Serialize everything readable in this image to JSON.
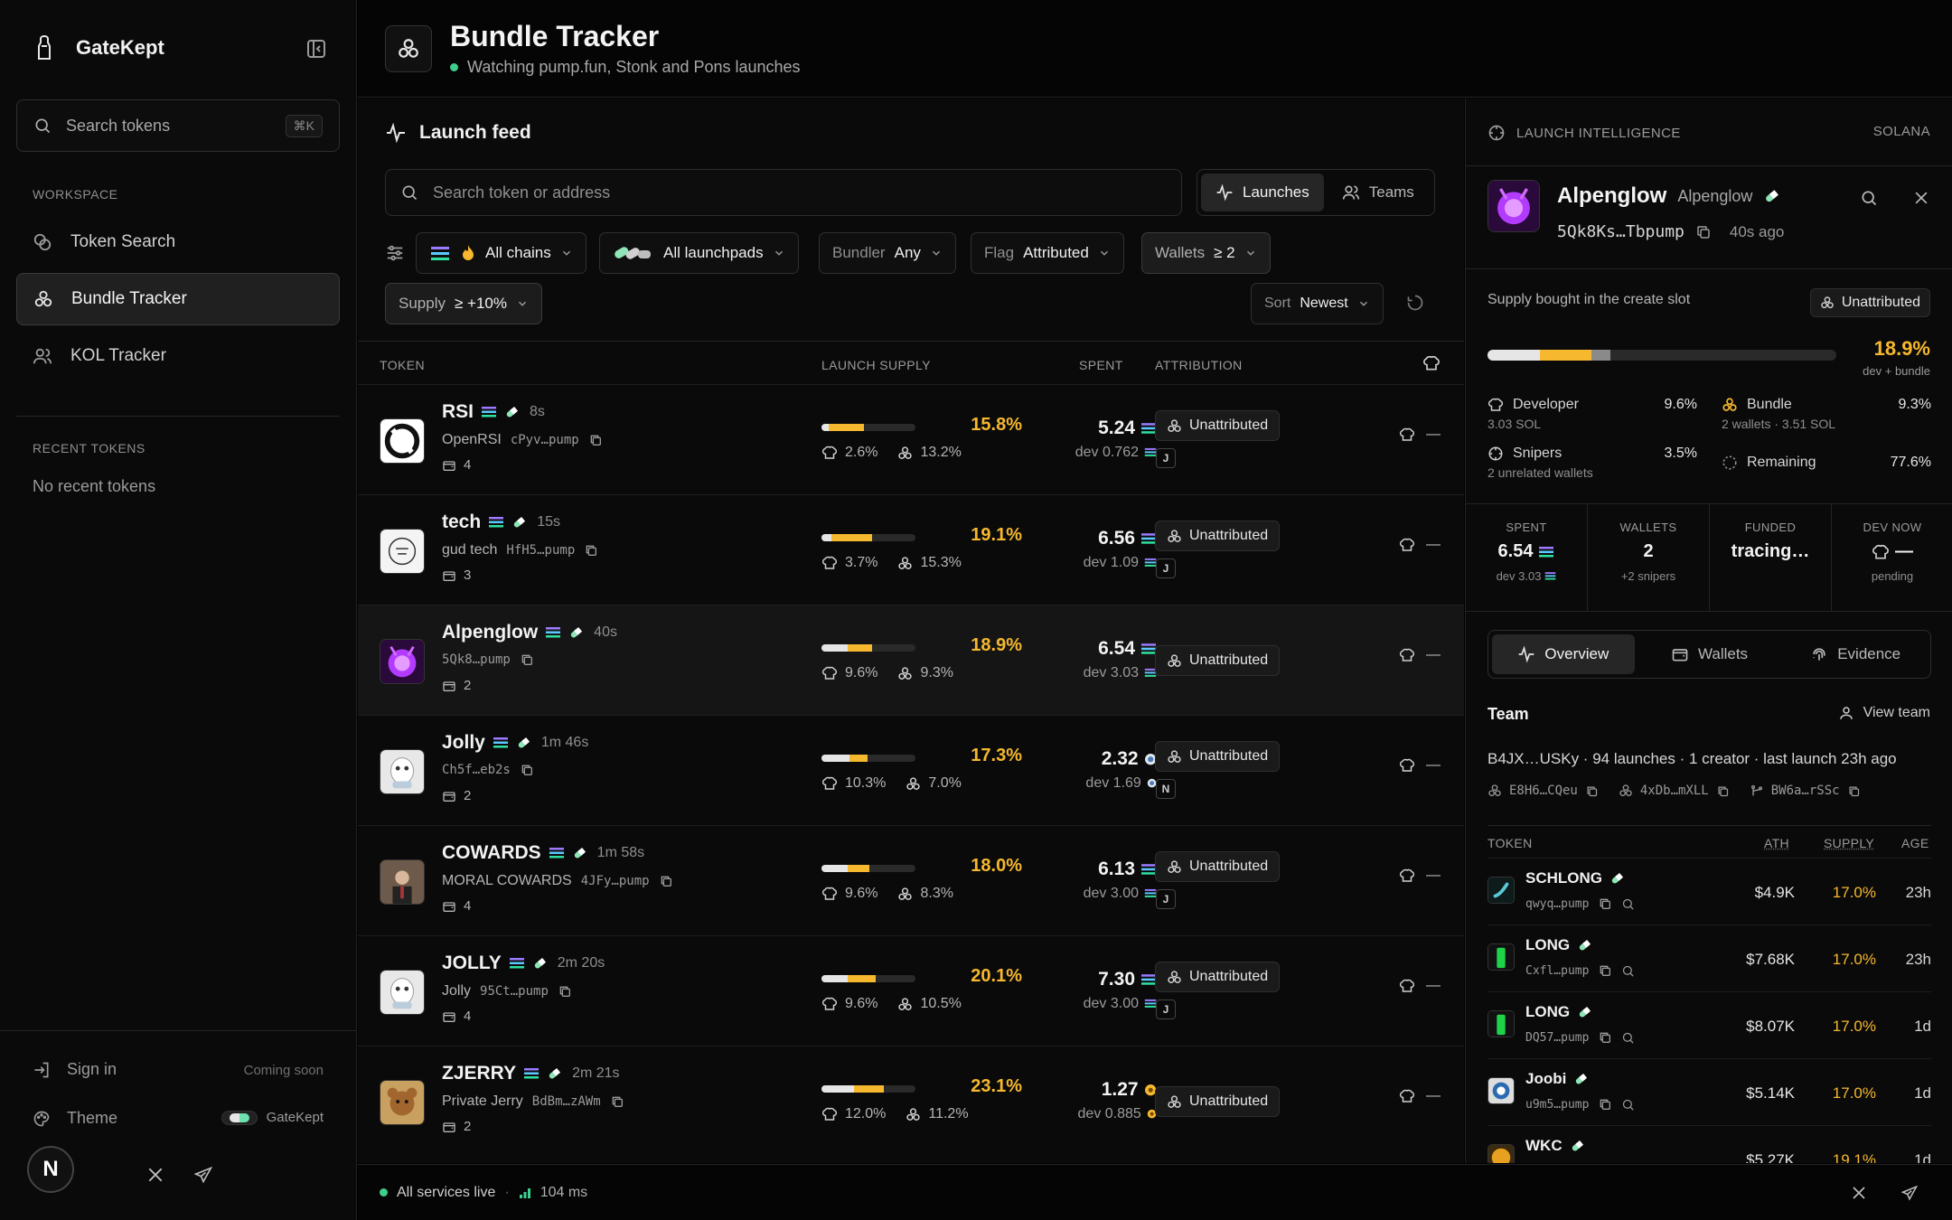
{
  "sidebar": {
    "brand": "GateKept",
    "search_placeholder": "Search tokens",
    "search_shortcut": "⌘K",
    "workspace_label": "WORKSPACE",
    "nav": [
      "Token Search",
      "Bundle Tracker",
      "KOL Tracker"
    ],
    "recent_label": "RECENT TOKENS",
    "recent_empty": "No recent tokens",
    "sign_in": "Sign in",
    "coming_soon": "Coming soon",
    "theme": "Theme",
    "theme_value": "GateKept",
    "avatar": "N"
  },
  "header": {
    "title": "Bundle Tracker",
    "subtitle": "Watching pump.fun, Stonk and Pons launches"
  },
  "feed": {
    "title": "Launch feed",
    "search_placeholder": "Search token or address",
    "modes": [
      "Launches",
      "Teams"
    ],
    "filters": {
      "chains": "All chains",
      "launchpads": "All launchpads",
      "bundler_k": "Bundler",
      "bundler_v": "Any",
      "flag_k": "Flag",
      "flag_v": "Attributed",
      "wallets_k": "Wallets",
      "wallets_v": "≥ 2",
      "supply_k": "Supply",
      "supply_v": "≥ +10%",
      "sort_k": "Sort",
      "sort_v": "Newest"
    },
    "columns": [
      "TOKEN",
      "LAUNCH SUPPLY",
      "SPENT",
      "ATTRIBUTION"
    ],
    "rows": [
      {
        "name": "RSI",
        "age": "8s",
        "desc": "OpenRSI",
        "addr": "cPyv…pump",
        "wallets": "4",
        "supply": "15.8%",
        "dev_pct": "2.6%",
        "bundle_pct": "13.2%",
        "dev_frac": 2.6,
        "bundle_frac": 13.2,
        "spent": "5.24",
        "dev_spent": "dev 0.762",
        "attribution": "Unattributed",
        "tag": "J",
        "coin": "sol",
        "img": "rsi"
      },
      {
        "name": "tech",
        "age": "15s",
        "desc": "gud tech",
        "addr": "HfH5…pump",
        "wallets": "3",
        "supply": "19.1%",
        "dev_pct": "3.7%",
        "bundle_pct": "15.3%",
        "dev_frac": 3.7,
        "bundle_frac": 15.3,
        "spent": "6.56",
        "dev_spent": "dev 1.09",
        "attribution": "Unattributed",
        "tag": "J",
        "coin": "sol",
        "img": "tech"
      },
      {
        "name": "Alpenglow",
        "age": "40s",
        "desc": "",
        "addr": "5Qk8…pump",
        "wallets": "2",
        "supply": "18.9%",
        "dev_pct": "9.6%",
        "bundle_pct": "9.3%",
        "dev_frac": 9.6,
        "bundle_frac": 9.3,
        "spent": "6.54",
        "dev_spent": "dev 3.03",
        "attribution": "Unattributed",
        "tag": "",
        "coin": "sol",
        "img": "alpen"
      },
      {
        "name": "Jolly",
        "age": "1m 46s",
        "desc": "",
        "addr": "Ch5f…eb2s",
        "wallets": "2",
        "supply": "17.3%",
        "dev_pct": "10.3%",
        "bundle_pct": "7.0%",
        "dev_frac": 10.3,
        "bundle_frac": 7.0,
        "spent": "2.32",
        "dev_spent": "dev 1.69",
        "attribution": "Unattributed",
        "tag": "N",
        "coin": "blue",
        "img": "jolly"
      },
      {
        "name": "COWARDS",
        "age": "1m 58s",
        "desc": "MORAL COWARDS",
        "addr": "4JFy…pump",
        "wallets": "4",
        "supply": "18.0%",
        "dev_pct": "9.6%",
        "bundle_pct": "8.3%",
        "dev_frac": 9.6,
        "bundle_frac": 8.3,
        "spent": "6.13",
        "dev_spent": "dev 3.00",
        "attribution": "Unattributed",
        "tag": "J",
        "coin": "sol",
        "img": "cow"
      },
      {
        "name": "JOLLY",
        "age": "2m 20s",
        "desc": "Jolly",
        "addr": "95Ct…pump",
        "wallets": "4",
        "supply": "20.1%",
        "dev_pct": "9.6%",
        "bundle_pct": "10.5%",
        "dev_frac": 9.6,
        "bundle_frac": 10.5,
        "spent": "7.30",
        "dev_spent": "dev 3.00",
        "attribution": "Unattributed",
        "tag": "J",
        "coin": "sol",
        "img": "jolly"
      },
      {
        "name": "ZJERRY",
        "age": "2m 21s",
        "desc": "Private Jerry",
        "addr": "BdBm…zAWm",
        "wallets": "2",
        "supply": "23.1%",
        "dev_pct": "12.0%",
        "bundle_pct": "11.2%",
        "dev_frac": 12.0,
        "bundle_frac": 11.2,
        "spent": "1.27",
        "dev_spent": "dev 0.885",
        "attribution": "Unattributed",
        "tag": "",
        "coin": "gold",
        "img": "jerry"
      }
    ],
    "dash": "—"
  },
  "status": {
    "text": "All services live",
    "latency": "104 ms"
  },
  "panel": {
    "head": "LAUNCH INTELLIGENCE",
    "chain": "SOLANA",
    "name": "Alpenglow",
    "symbol": "Alpenglow",
    "addr": "5Qk8Ks…Tbpump",
    "ago": "40s ago",
    "supply_label": "Supply bought in the create slot",
    "badge": "Unattributed",
    "pct": "18.9%",
    "pct_sub": "dev + bundle",
    "dev_frac": 9.6,
    "bundle_frac": 9.3,
    "sniper_frac": 3.5,
    "developer": {
      "label": "Developer",
      "pct": "9.6%",
      "sub": "3.03 SOL"
    },
    "bundle": {
      "label": "Bundle",
      "pct": "9.3%",
      "sub": "2 wallets · 3.51 SOL"
    },
    "snipers": {
      "label": "Snipers",
      "pct": "3.5%",
      "sub": "2 unrelated wallets"
    },
    "remaining": {
      "label": "Remaining",
      "pct": "77.6%"
    },
    "stats": [
      {
        "t": "SPENT",
        "v": "6.54",
        "s": "dev 3.03"
      },
      {
        "t": "WALLETS",
        "v": "2",
        "s": "+2 snipers"
      },
      {
        "t": "FUNDED",
        "v": "tracing…",
        "s": ""
      },
      {
        "t": "DEV NOW",
        "v": "—",
        "s": "pending"
      }
    ],
    "tabs": [
      "Overview",
      "Wallets",
      "Evidence"
    ],
    "team_title": "Team",
    "view_team": "View team",
    "team_line": "B4JX…USKy · 94 launches · 1 creator · last launch 23h ago",
    "team_wallets": [
      "E8H6…CQeu",
      "4xDb…mXLL",
      "BW6a…rSSc"
    ],
    "tbl_cols": [
      "TOKEN",
      "ATH",
      "SUPPLY",
      "AGE"
    ],
    "tokens": [
      {
        "n": "SCHLONG",
        "a": "qwyq…pump",
        "ath": "$4.9K",
        "sup": "17.0%",
        "age": "23h",
        "img": "sch"
      },
      {
        "n": "LONG",
        "a": "Cxfl…pump",
        "ath": "$7.68K",
        "sup": "17.0%",
        "age": "23h",
        "img": "long"
      },
      {
        "n": "LONG",
        "a": "DQ57…pump",
        "ath": "$8.07K",
        "sup": "17.0%",
        "age": "1d",
        "img": "long"
      },
      {
        "n": "Joobi",
        "a": "u9m5…pump",
        "ath": "$5.14K",
        "sup": "17.0%",
        "age": "1d",
        "img": "joobi"
      },
      {
        "n": "WKC",
        "a": "",
        "ath": "$5.27K",
        "sup": "19.1%",
        "age": "1d",
        "img": "wkc"
      }
    ]
  },
  "colors": {
    "accent": "#f6b82e",
    "green": "#3ecf8e",
    "bg": "#000000"
  }
}
